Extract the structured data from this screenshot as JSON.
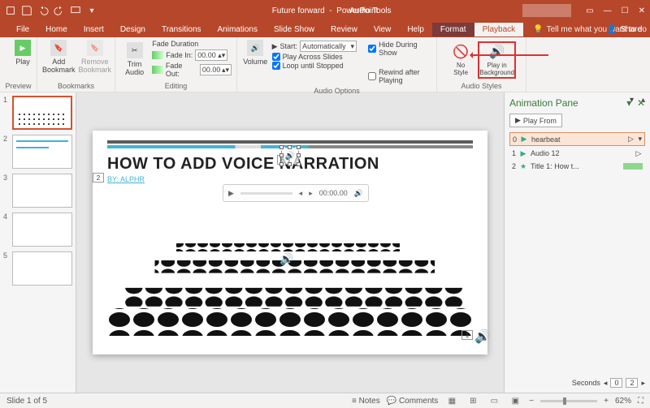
{
  "titlebar": {
    "doc_title": "Future forward",
    "app_name": "PowerPoint",
    "contextual_tab": "Audio Tools"
  },
  "tabs": {
    "file": "File",
    "home": "Home",
    "insert": "Insert",
    "design": "Design",
    "transitions": "Transitions",
    "animations": "Animations",
    "slideshow": "Slide Show",
    "review": "Review",
    "view": "View",
    "help": "Help",
    "format": "Format",
    "playback": "Playback",
    "tellme": "Tell me what you want to do",
    "share": "Share"
  },
  "ribbon": {
    "preview": {
      "play": "Play",
      "label": "Preview"
    },
    "bookmarks": {
      "add": "Add\nBookmark",
      "remove": "Remove\nBookmark",
      "label": "Bookmarks"
    },
    "editing": {
      "trim": "Trim\nAudio",
      "fade_duration": "Fade Duration",
      "fade_in": "Fade In:",
      "fade_in_val": "00.00",
      "fade_out": "Fade Out:",
      "fade_out_val": "00.00",
      "label": "Editing"
    },
    "audio_options": {
      "volume": "Volume",
      "start": "Start:",
      "start_val": "Automatically",
      "across": "Play Across Slides",
      "loop": "Loop until Stopped",
      "hide": "Hide During Show",
      "rewind": "Rewind after Playing",
      "label": "Audio Options"
    },
    "audio_styles": {
      "nostyle": "No\nStyle",
      "playbg": "Play in\nBackground",
      "label": "Audio Styles"
    }
  },
  "slide": {
    "title": "HOW TO ADD VOICE NARRATION",
    "by": "BY:",
    "author": "ALPHR",
    "player_time": "00:00.00",
    "thumb_numbers": [
      "1",
      "2",
      "3",
      "4",
      "5"
    ],
    "box2": "2",
    "box0": "0",
    "box1": "1"
  },
  "anim_pane": {
    "title": "Animation Pane",
    "play_from": "Play From",
    "items": [
      {
        "idx": "0",
        "name": "hearbeat",
        "color": "#f4c486"
      },
      {
        "idx": "1",
        "name": "Audio 12",
        "color": "#f4c486"
      },
      {
        "idx": "2",
        "name": "Title 1: How t...",
        "color": "#8fd68f"
      }
    ],
    "seconds": "Seconds",
    "sec_val": "0",
    "sec_val2": "2"
  },
  "status": {
    "slide_of": "Slide 1 of 5",
    "notes": "Notes",
    "comments": "Comments",
    "zoom": "62%"
  }
}
